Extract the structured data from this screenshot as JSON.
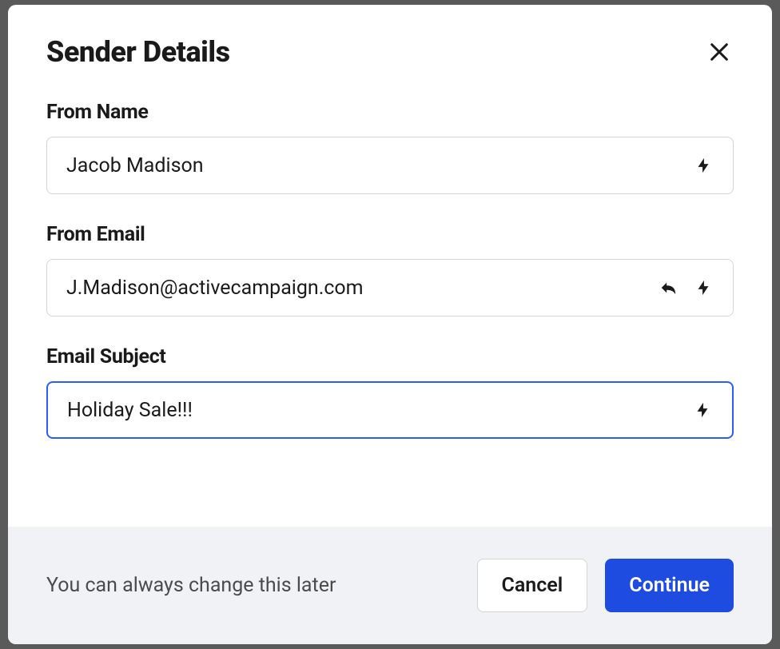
{
  "modal": {
    "title": "Sender Details",
    "fields": {
      "from_name": {
        "label": "From Name",
        "value": "Jacob Madison"
      },
      "from_email": {
        "label": "From Email",
        "value": "J.Madison@activecampaign.com"
      },
      "email_subject": {
        "label": "Email Subject",
        "value": "Holiday Sale!!!"
      }
    },
    "footer": {
      "helper_text": "You can always change this later",
      "cancel_label": "Cancel",
      "continue_label": "Continue"
    }
  }
}
